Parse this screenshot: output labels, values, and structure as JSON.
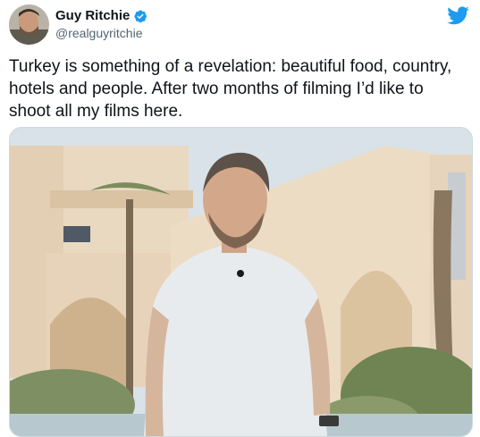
{
  "author": {
    "display_name": "Guy Ritchie",
    "handle": "@realguyritchie",
    "verified": true
  },
  "tweet": {
    "text": "Turkey is something of a revelation: beautiful food, country, hotels and people. After two months of filming I’d like to shoot all my films here."
  },
  "icons": {
    "brand": "twitter-bird-icon",
    "verified": "verified-badge-icon"
  },
  "colors": {
    "twitter_blue": "#1d9bf0",
    "handle_gray": "#536471",
    "text": "#0f1419"
  }
}
